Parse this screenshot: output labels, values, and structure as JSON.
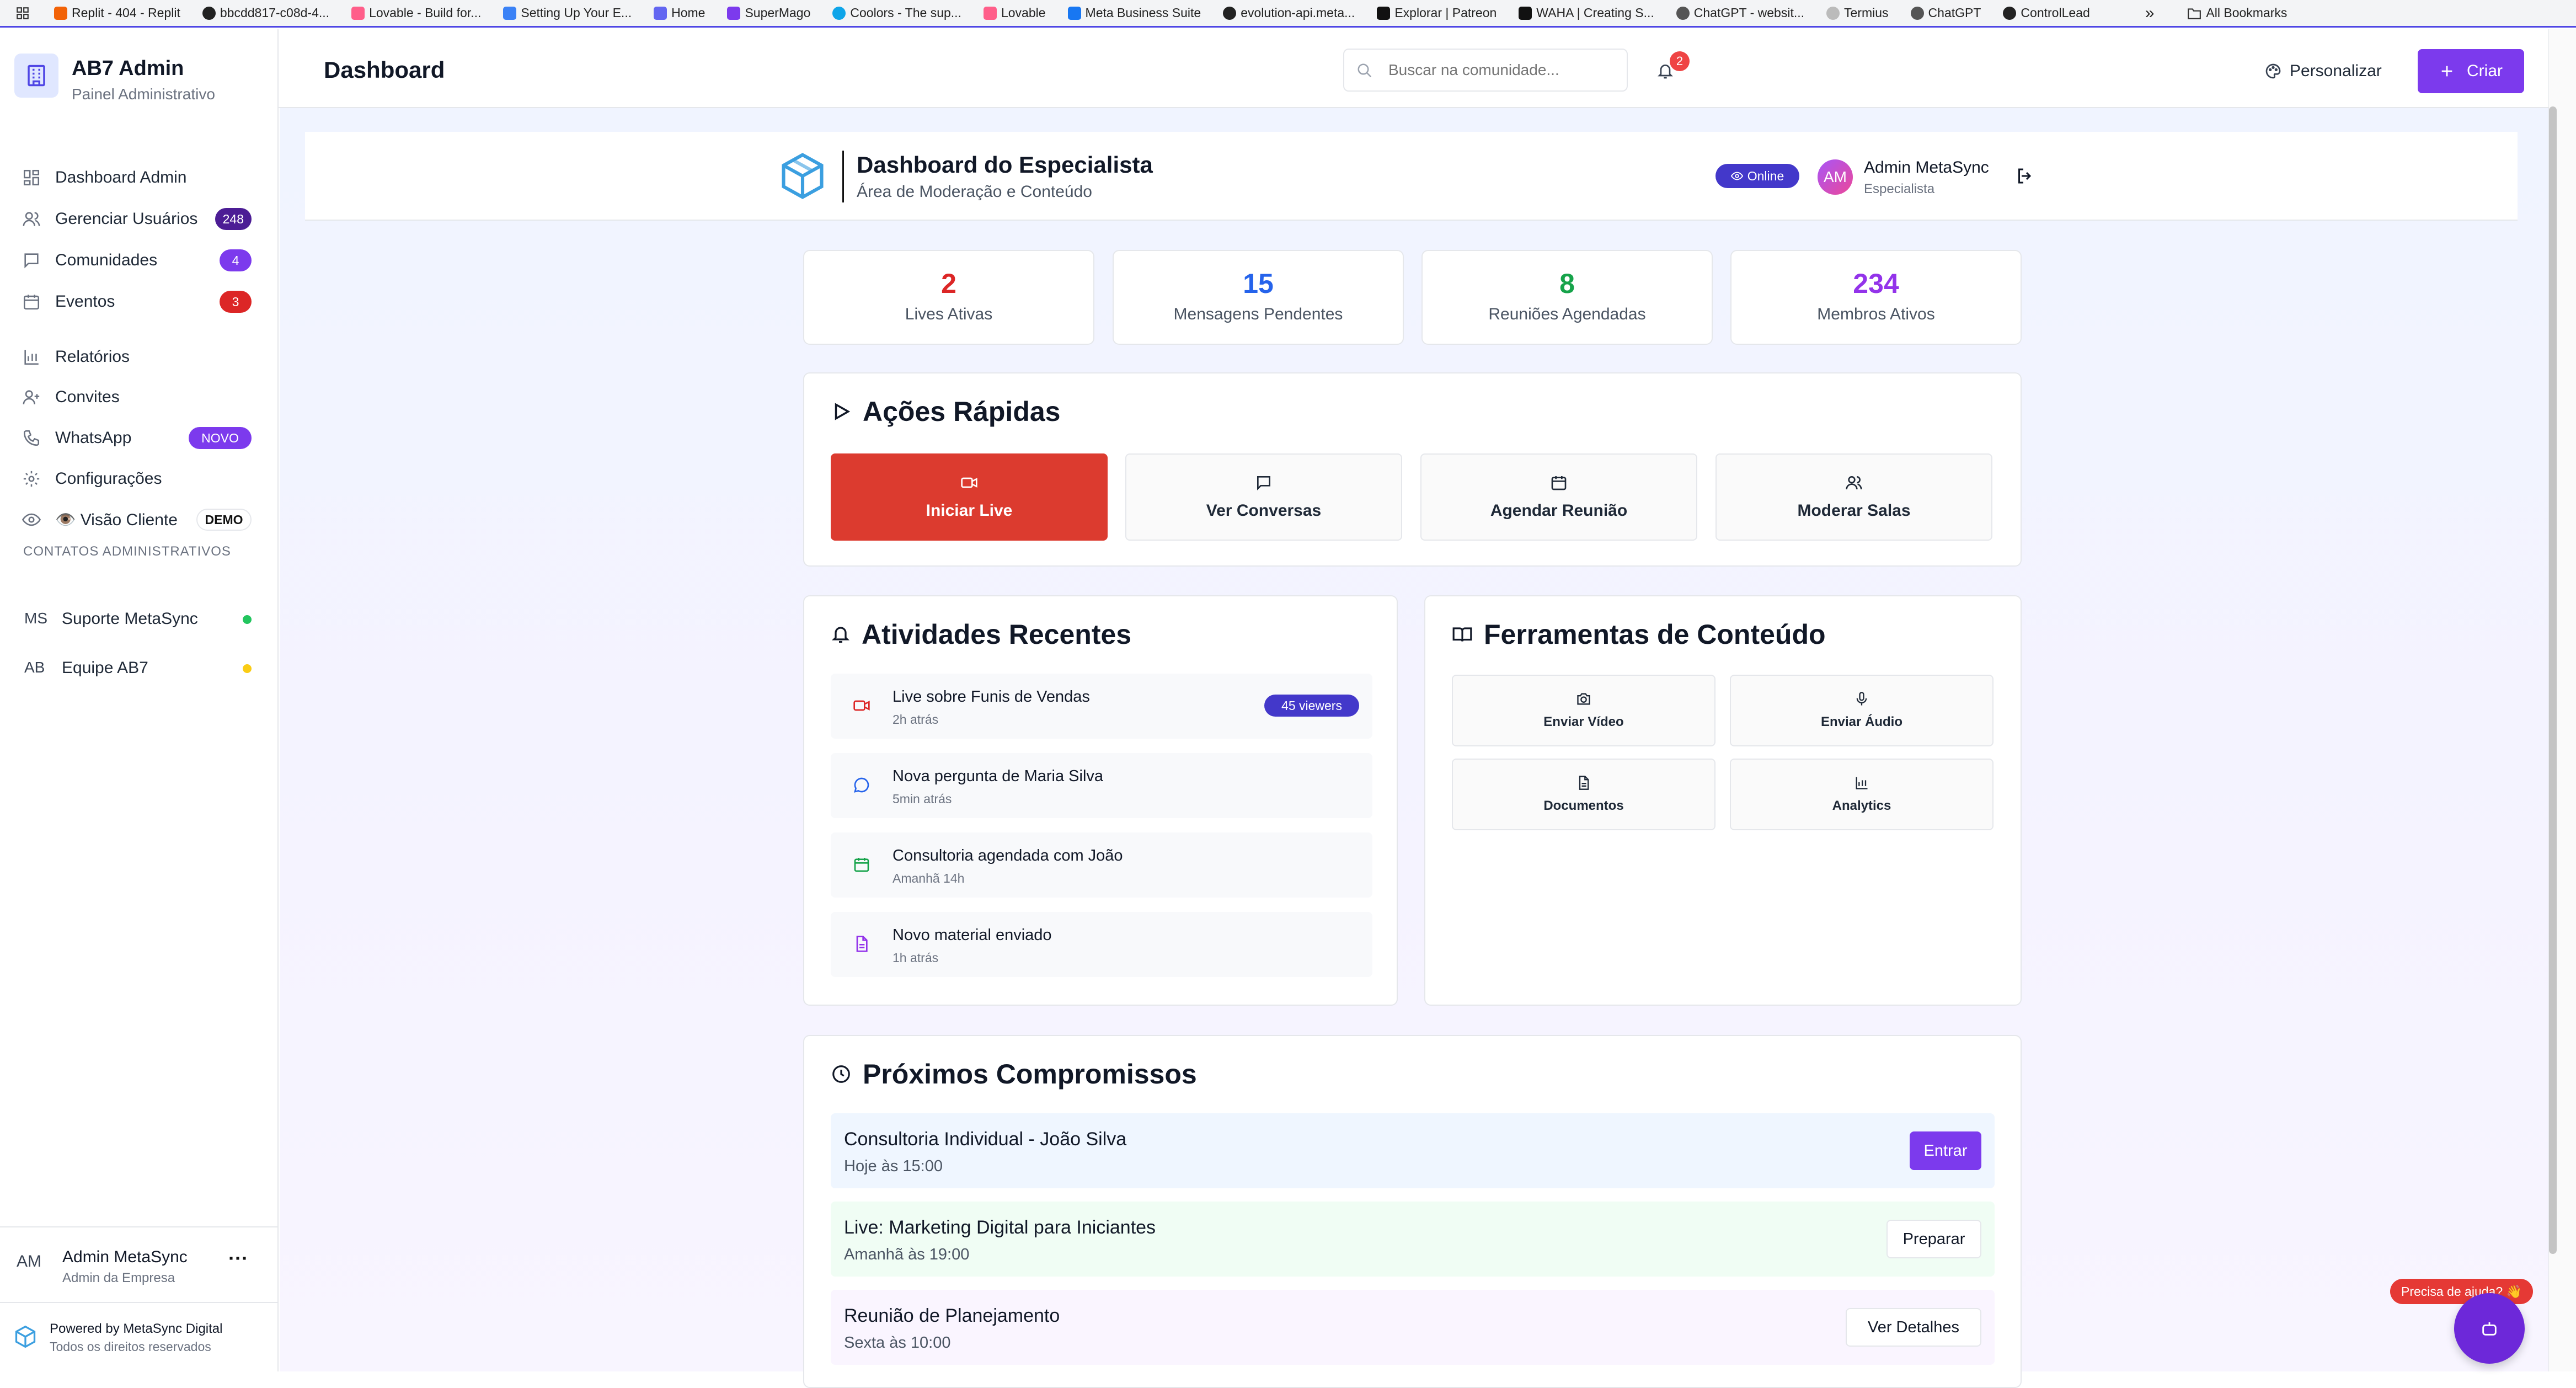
{
  "bookmarks": {
    "items": [
      "Replit - 404 - Replit",
      "bbcdd817-c08d-4...",
      "Lovable - Build for...",
      "Setting Up Your E...",
      "Home",
      "SuperMago",
      "Coolors - The sup...",
      "Lovable",
      "Meta Business Suite",
      "evolution-api.meta...",
      "Explorar | Patreon",
      "WAHA | Creating S...",
      "ChatGPT - websit...",
      "Termius",
      "ChatGPT",
      "ControlLead"
    ],
    "more": "»",
    "all": "All Bookmarks"
  },
  "sidebar": {
    "brand_title": "AB7 Admin",
    "brand_subtitle": "Painel Administrativo",
    "nav": [
      {
        "label": "Dashboard Admin",
        "icon": "grid-icon"
      },
      {
        "label": "Gerenciar Usuários",
        "icon": "users-icon",
        "badge": "248"
      },
      {
        "label": "Comunidades",
        "icon": "message-icon",
        "badge": "4"
      },
      {
        "label": "Eventos",
        "icon": "calendar-icon",
        "badge": "3"
      },
      {
        "label": "Relatórios",
        "icon": "bar-chart-icon"
      },
      {
        "label": "Convites",
        "icon": "user-plus-icon"
      },
      {
        "label": "WhatsApp",
        "icon": "phone-icon",
        "badge": "NOVO"
      },
      {
        "label": "Configurações",
        "icon": "gear-icon"
      },
      {
        "label": "👁️ Visão Cliente",
        "icon": "eye-icon",
        "badge": "DEMO"
      }
    ],
    "contacts_heading": "CONTATOS ADMINISTRATIVOS",
    "contacts": [
      {
        "initials": "MS",
        "name": "Suporte MetaSync",
        "status_color": "#22c55e"
      },
      {
        "initials": "AB",
        "name": "Equipe AB7",
        "status_color": "#facc15"
      }
    ],
    "user": {
      "initials": "AM",
      "name": "Admin MetaSync",
      "role": "Admin da Empresa",
      "menu": "···"
    },
    "footer": {
      "line1": "Powered by MetaSync Digital",
      "line2": "Todos os direitos reservados"
    }
  },
  "topbar": {
    "title": "Dashboard",
    "search_placeholder": "Buscar na comunidade...",
    "notification_count": "2",
    "personalize_label": "Personalizar",
    "create_label": "Criar"
  },
  "expert_header": {
    "title": "Dashboard do Especialista",
    "subtitle": "Área de Moderação e Conteúdo",
    "status": "Online",
    "avatar": "AM",
    "user_name": "Admin MetaSync",
    "user_role": "Especialista"
  },
  "stats": [
    {
      "value": "2",
      "label": "Lives Ativas",
      "color": "#dc2626"
    },
    {
      "value": "15",
      "label": "Mensagens Pendentes",
      "color": "#2563eb"
    },
    {
      "value": "8",
      "label": "Reuniões Agendadas",
      "color": "#16a34a"
    },
    {
      "value": "234",
      "label": "Membros Ativos",
      "color": "#9333ea"
    }
  ],
  "quick_actions": {
    "title": "Ações Rápidas",
    "items": [
      {
        "label": "Iniciar Live",
        "icon": "video-icon"
      },
      {
        "label": "Ver Conversas",
        "icon": "message-icon"
      },
      {
        "label": "Agendar Reunião",
        "icon": "calendar-icon"
      },
      {
        "label": "Moderar Salas",
        "icon": "users-icon"
      }
    ]
  },
  "recent": {
    "title": "Atividades Recentes",
    "items": [
      {
        "title": "Live sobre Funis de Vendas",
        "time": "2h atrás",
        "icon": "video-icon",
        "color": "#dc2626",
        "badge": "45 viewers"
      },
      {
        "title": "Nova pergunta de Maria Silva",
        "time": "5min atrás",
        "icon": "message-icon",
        "color": "#2563eb"
      },
      {
        "title": "Consultoria agendada com João",
        "time": "Amanhã 14h",
        "icon": "calendar-icon",
        "color": "#16a34a"
      },
      {
        "title": "Novo material enviado",
        "time": "1h atrás",
        "icon": "document-icon",
        "color": "#9333ea"
      }
    ]
  },
  "tools": {
    "title": "Ferramentas de Conteúdo",
    "items": [
      {
        "label": "Enviar Vídeo",
        "icon": "camera-icon"
      },
      {
        "label": "Enviar Áudio",
        "icon": "microphone-icon"
      },
      {
        "label": "Documentos",
        "icon": "document-icon"
      },
      {
        "label": "Analytics",
        "icon": "bar-chart-icon"
      }
    ]
  },
  "appointments": {
    "title": "Próximos Compromissos",
    "items": [
      {
        "title": "Consultoria Individual - João Silva",
        "time": "Hoje às 15:00",
        "action": "Entrar",
        "bg": "#eff6ff"
      },
      {
        "title": "Live: Marketing Digital para Iniciantes",
        "time": "Amanhã às 19:00",
        "action": "Preparar",
        "bg": "#f0fdf4"
      },
      {
        "title": "Reunião de Planejamento",
        "time": "Sexta às 10:00",
        "action": "Ver Detalhes",
        "bg": "#faf5ff"
      }
    ]
  },
  "help": {
    "label": "Precisa de ajuda? 👋"
  },
  "colors": {
    "accent": "#7c3aed",
    "danger": "#dc2626",
    "sidebar_border": "#e5e7eb"
  }
}
